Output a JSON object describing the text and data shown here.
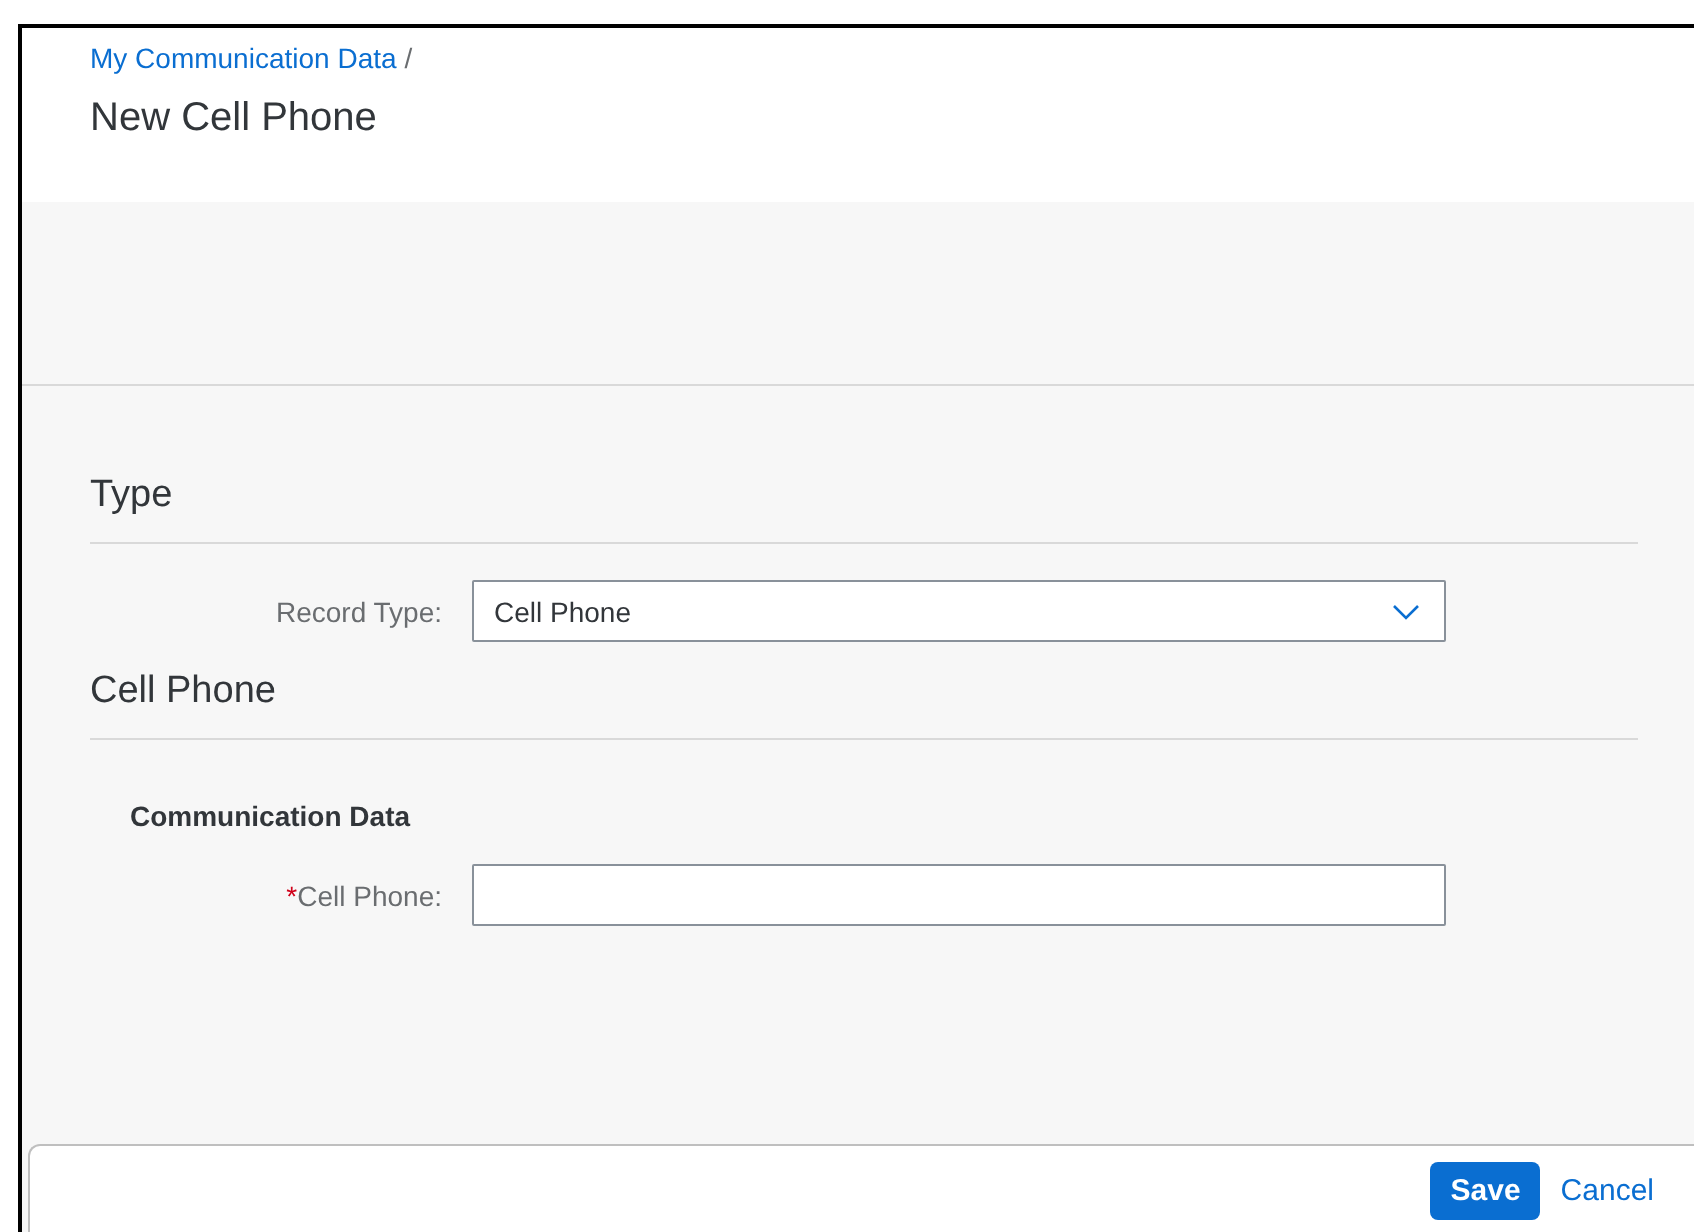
{
  "breadcrumb": {
    "link": "My Communication Data",
    "separator": "/"
  },
  "title": "New Cell Phone",
  "sections": [
    {
      "heading": "Type",
      "fields": [
        {
          "kind": "select",
          "label": "Record Type:",
          "value": "Cell Phone"
        }
      ]
    },
    {
      "heading": "Cell Phone",
      "subheading": "Communication Data",
      "fields": [
        {
          "kind": "input",
          "label": "Cell Phone:",
          "required_mark": "*"
        }
      ]
    }
  ],
  "footer": {
    "buttons": [
      {
        "label": "Save",
        "kind": "primary"
      },
      {
        "label": "Cancel",
        "kind": "link"
      }
    ]
  }
}
